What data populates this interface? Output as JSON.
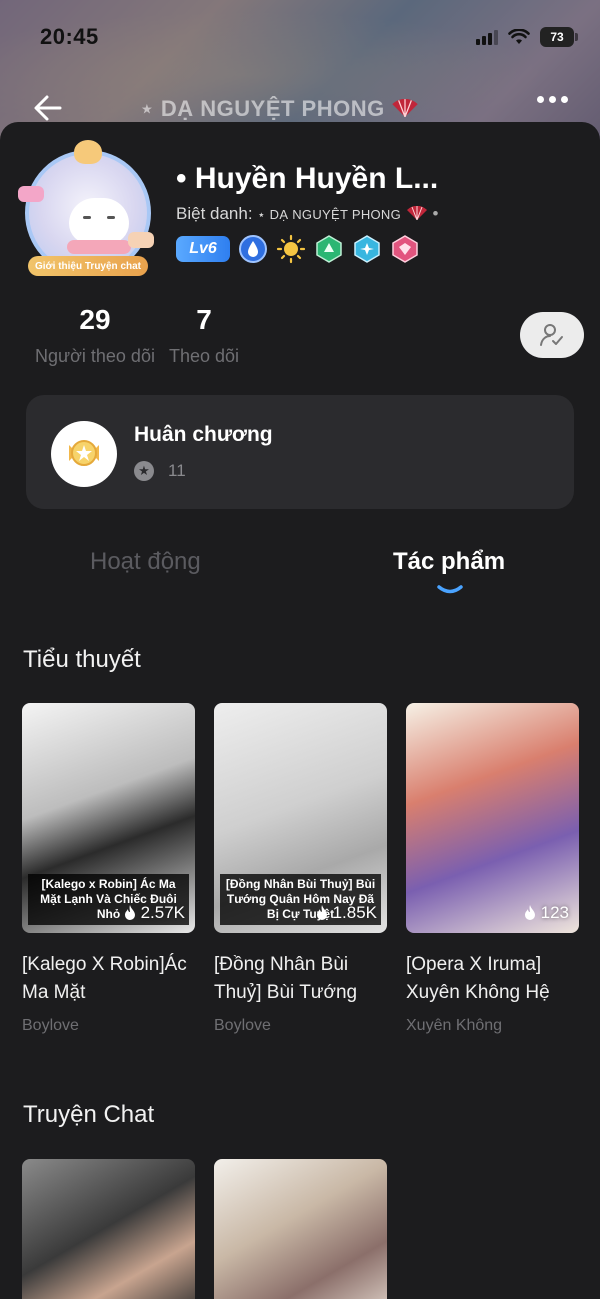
{
  "status_bar": {
    "time": "20:45",
    "battery": "73"
  },
  "nav": {
    "title": "⋆ DẠ NGUYỆT PHONG"
  },
  "profile": {
    "name": "• Huyền Huyền L...",
    "nickname_label": "Biệt danh:",
    "nickname": "⋆ DẠ NGUYỆT PHONG",
    "avatar_tag": "Giới thiệu Truyện chat",
    "level": "Lv6",
    "badge_icons": [
      "blue-drop-badge",
      "sun-badge",
      "green-gem-badge",
      "cyan-gem-badge",
      "pink-gem-badge"
    ]
  },
  "stats": [
    {
      "value": "29",
      "label": "Người theo dõi"
    },
    {
      "value": "7",
      "label": "Theo dõi"
    }
  ],
  "medals": {
    "title": "Huân chương",
    "count": "11"
  },
  "tabs": {
    "inactive": "Hoạt động",
    "active": "Tác phẩm"
  },
  "sections": {
    "novels": "Tiểu thuyết",
    "chat_stories": "Truyện Chat"
  },
  "novels": [
    {
      "caption": "[Kalego x Robin] Ác Ma Mặt Lạnh Và Chiếc Đuôi Nhỏ",
      "views": "2.57K",
      "title": "[Kalego X Robin]Ác Ma Mặt",
      "genre": "Boylove"
    },
    {
      "caption": "[Đồng Nhân Bùi Thuỷ] Bùi Tướng Quân Hôm Nay Đã Bị Cự Tuyệt",
      "views": "1.85K",
      "title": "[Đồng Nhân Bùi Thuỷ] Bùi Tướng",
      "genre": "Boylove"
    },
    {
      "caption": "",
      "views": "123",
      "title": "[Opera X Iruma] Xuyên Không Hệ",
      "genre": "Xuyên Không"
    }
  ],
  "colors": {
    "accent": "#4aa3ff",
    "level_badge": "#2f7ff0",
    "background": "#1c1c1e",
    "card": "#2b2b2e"
  }
}
